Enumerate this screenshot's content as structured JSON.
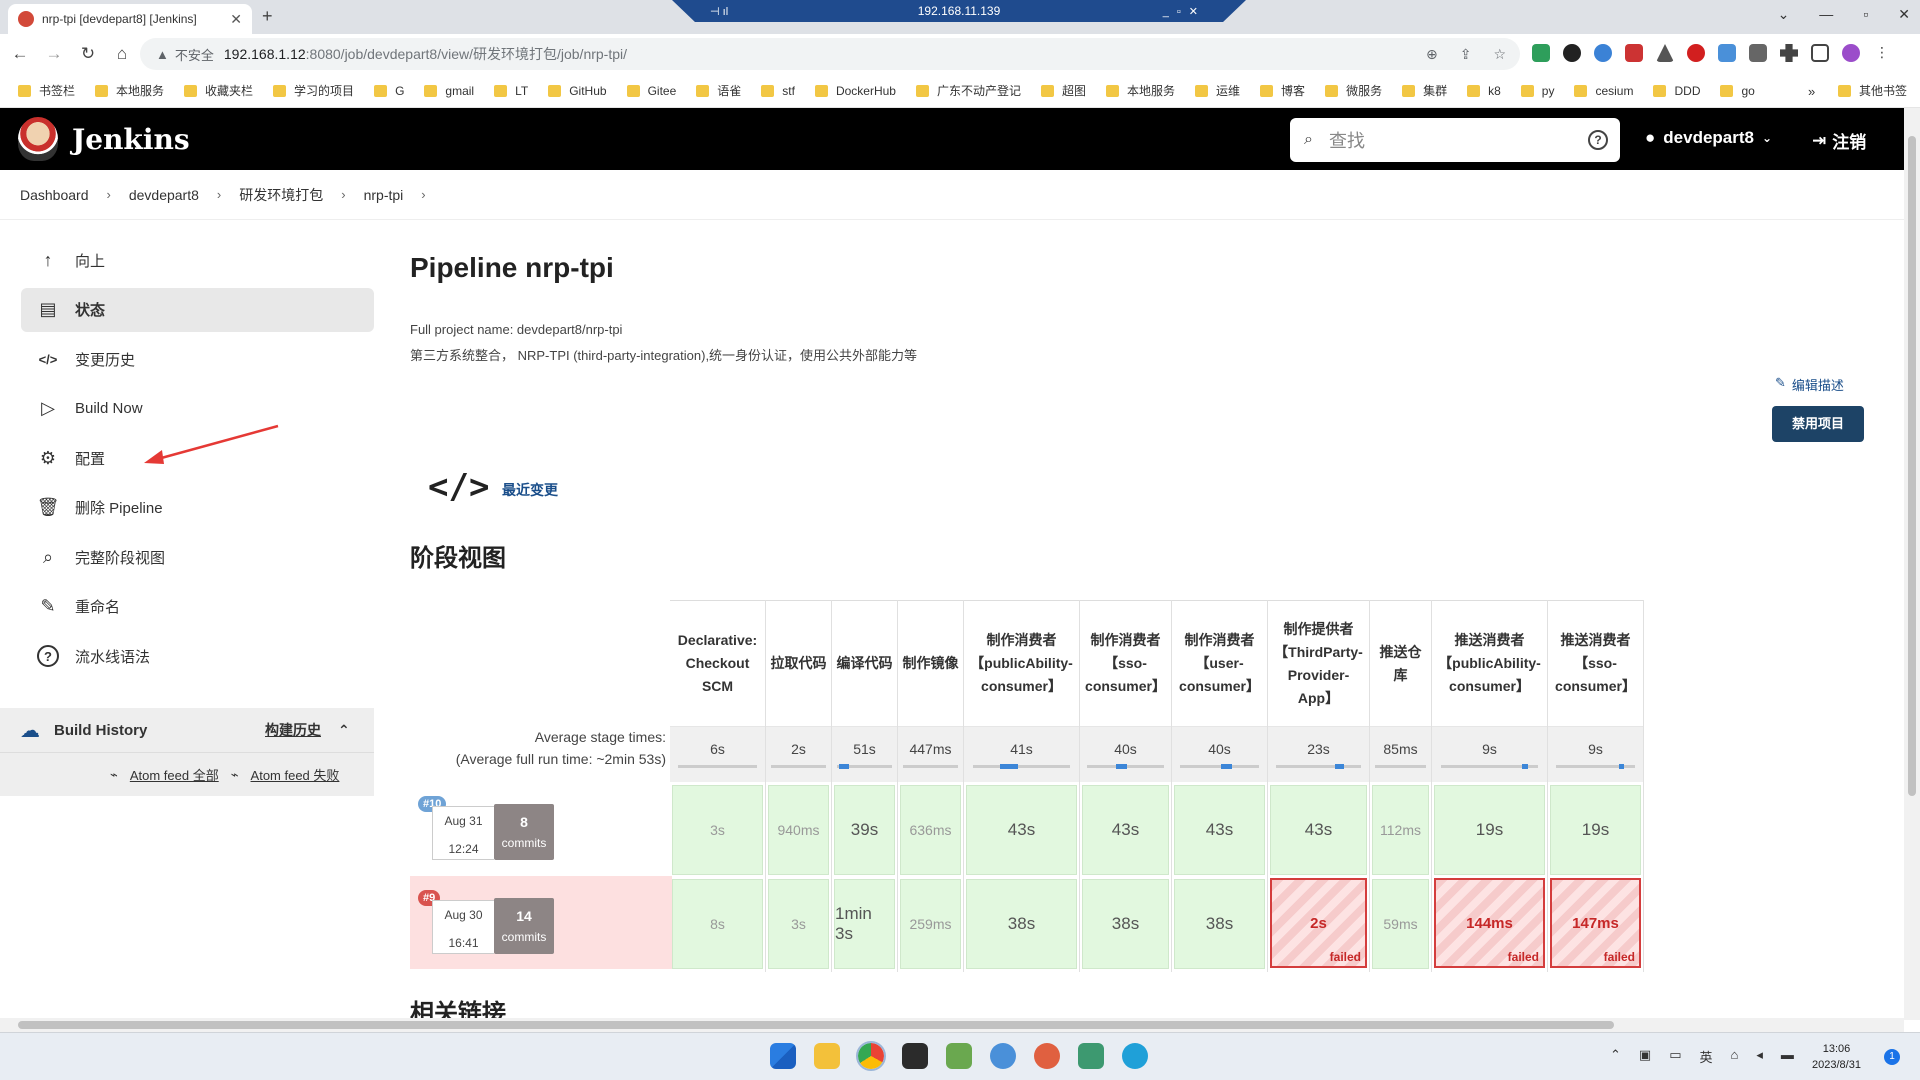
{
  "browser": {
    "tab_title": "nrp-tpi [devdepart8] [Jenkins]",
    "remote_ip": "192.168.11.139",
    "insecure_label": "不安全",
    "url_host": "192.168.1.12",
    "url_path": ":8080/job/devdepart8/view/研发环境打包/job/nrp-tpi/"
  },
  "bookmarks": [
    "书签栏",
    "本地服务",
    "收藏夹栏",
    "学习的项目",
    "G",
    "gmail",
    "LT",
    "GitHub",
    "Gitee",
    "语雀",
    "stf",
    "DockerHub",
    "广东不动产登记",
    "超图",
    "本地服务",
    "运维",
    "博客",
    "微服务",
    "集群",
    "k8",
    "py",
    "cesium",
    "DDD",
    "go"
  ],
  "bookmark_more": "»",
  "bookmark_other": "其他书签",
  "header": {
    "title": "Jenkins",
    "search_placeholder": "查找",
    "user": "devdepart8",
    "logout": "注销"
  },
  "breadcrumb": [
    "Dashboard",
    "devdepart8",
    "研发环境打包",
    "nrp-tpi"
  ],
  "sidebar": {
    "items": [
      {
        "label": "向上",
        "icon": "arrow-up-icon"
      },
      {
        "label": "状态",
        "icon": "document-icon",
        "active": true
      },
      {
        "label": "变更历史",
        "icon": "code-icon"
      },
      {
        "label": "Build Now",
        "icon": "play-icon"
      },
      {
        "label": "配置",
        "icon": "gear-icon"
      },
      {
        "label": "删除 Pipeline",
        "icon": "trash-icon"
      },
      {
        "label": "完整阶段视图",
        "icon": "search-icon"
      },
      {
        "label": "重命名",
        "icon": "pencil-icon"
      },
      {
        "label": "流水线语法",
        "icon": "help-icon"
      }
    ],
    "build_history_label": "Build History",
    "build_history_link": "构建历史",
    "feed_all": "Atom feed 全部",
    "feed_fail": "Atom feed 失败"
  },
  "main": {
    "title": "Pipeline nrp-tpi",
    "full_name": "Full project name: devdepart8/nrp-tpi",
    "description": "第三方系统整合， NRP-TPI (third-party-integration),统一身份认证，使用公共外部能力等",
    "edit_description": "编辑描述",
    "disable_button": "禁用项目",
    "recent_changes": "最近变更",
    "stage_view_title": "阶段视图",
    "avg_stage_times": "Average stage times:",
    "avg_run_time": "(Average full run time: ~2min 53s)",
    "related_links": "相关链接"
  },
  "stages": [
    {
      "name": "Declarative: Checkout SCM",
      "avg": "6s"
    },
    {
      "name": "拉取代码",
      "avg": "2s"
    },
    {
      "name": "编译代码",
      "avg": "51s"
    },
    {
      "name": "制作镜像",
      "avg": "447ms"
    },
    {
      "name": "制作消费者【publicAbility-consumer】",
      "avg": "41s"
    },
    {
      "name": "制作消费者【sso-consumer】",
      "avg": "40s"
    },
    {
      "name": "制作消费者【user-consumer】",
      "avg": "40s"
    },
    {
      "name": "制作提供者【ThirdParty-Provider-App】",
      "avg": "23s"
    },
    {
      "name": "推送仓库",
      "avg": "85ms"
    },
    {
      "name": "推送消费者【publicAbility-consumer】",
      "avg": "9s"
    },
    {
      "name": "推送消费者【sso-consumer】",
      "avg": "9s"
    }
  ],
  "runs": [
    {
      "num": "#10",
      "date": "Aug 31",
      "time": "12:24",
      "commits_count": "8",
      "commits_label": "commits",
      "status": "success",
      "cells": [
        {
          "t": "3s"
        },
        {
          "t": "940ms"
        },
        {
          "t": "39s"
        },
        {
          "t": "636ms"
        },
        {
          "t": "43s"
        },
        {
          "t": "43s"
        },
        {
          "t": "43s"
        },
        {
          "t": "43s"
        },
        {
          "t": "112ms"
        },
        {
          "t": "19s"
        },
        {
          "t": "19s"
        }
      ]
    },
    {
      "num": "#9",
      "date": "Aug 30",
      "time": "16:41",
      "commits_count": "14",
      "commits_label": "commits",
      "status": "failed",
      "cells": [
        {
          "t": "8s"
        },
        {
          "t": "3s"
        },
        {
          "t": "1min 3s"
        },
        {
          "t": "259ms"
        },
        {
          "t": "38s"
        },
        {
          "t": "38s"
        },
        {
          "t": "38s"
        },
        {
          "t": "2s",
          "fail": true
        },
        {
          "t": "59ms"
        },
        {
          "t": "144ms",
          "fail": true
        },
        {
          "t": "147ms",
          "fail": true
        }
      ]
    }
  ],
  "failed_label": "failed",
  "taskbar": {
    "lang": "英",
    "time": "13:06",
    "date": "2023/8/31",
    "notifications": "1"
  }
}
